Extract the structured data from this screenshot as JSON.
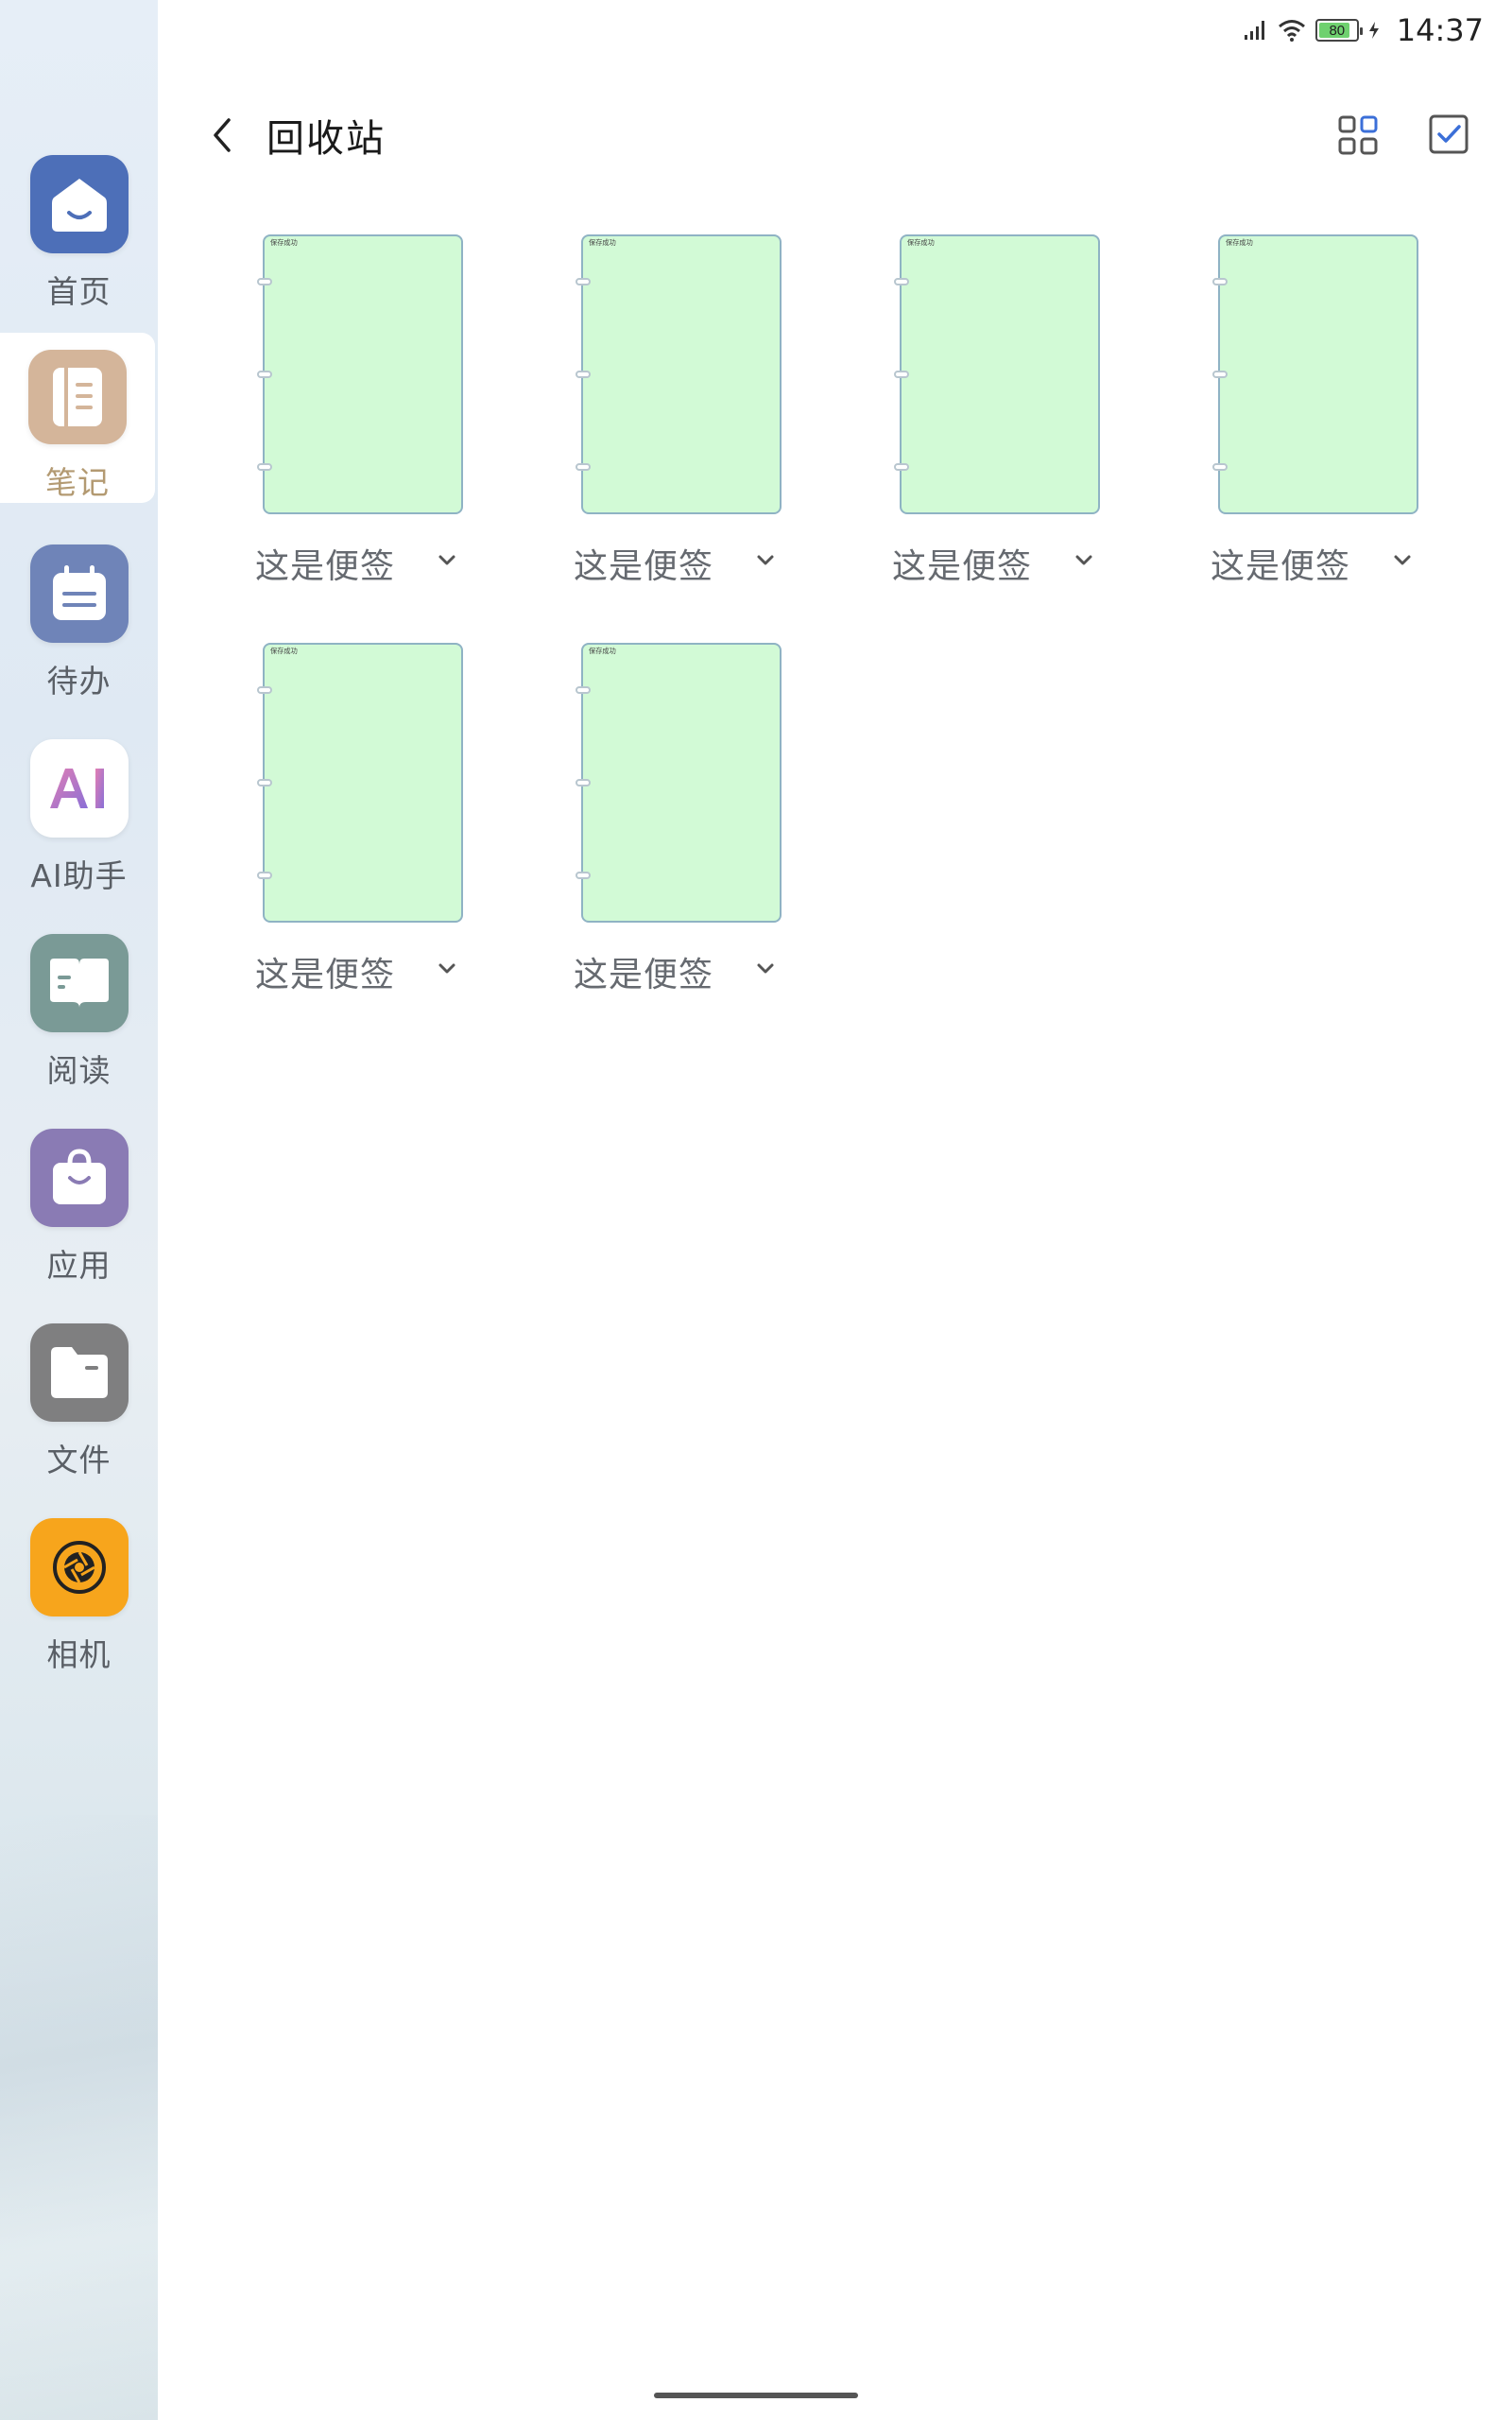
{
  "status": {
    "time": "14:37",
    "battery": "80"
  },
  "header": {
    "title": "回收站"
  },
  "sidebar": {
    "items": [
      {
        "label": "首页",
        "icon": "home-icon",
        "color": "#4d6fb8"
      },
      {
        "label": "笔记",
        "icon": "notebook-icon",
        "color": "#d4b59a"
      },
      {
        "label": "待办",
        "icon": "calendar-icon",
        "color": "#6f84b8"
      },
      {
        "label": "AI助手",
        "icon": "ai-icon",
        "color": "#ffffff"
      },
      {
        "label": "阅读",
        "icon": "book-icon",
        "color": "#7a9a96"
      },
      {
        "label": "应用",
        "icon": "bag-icon",
        "color": "#8a7bb4"
      },
      {
        "label": "文件",
        "icon": "folder-icon",
        "color": "#7f7f80"
      },
      {
        "label": "相机",
        "icon": "camera-icon",
        "color": "#f7a51c"
      }
    ],
    "active_index": 1
  },
  "notes": [
    {
      "title": "这是便签",
      "thumb_text": "保存成功"
    },
    {
      "title": "这是便签",
      "thumb_text": "保存成功"
    },
    {
      "title": "这是便签",
      "thumb_text": "保存成功"
    },
    {
      "title": "这是便签",
      "thumb_text": "保存成功"
    },
    {
      "title": "这是便签",
      "thumb_text": "保存成功"
    },
    {
      "title": "这是便签",
      "thumb_text": "保存成功"
    }
  ],
  "colors": {
    "note_fill": "#d2fad6",
    "note_border": "#8fb3c4",
    "accent": "#3b6fd8"
  }
}
